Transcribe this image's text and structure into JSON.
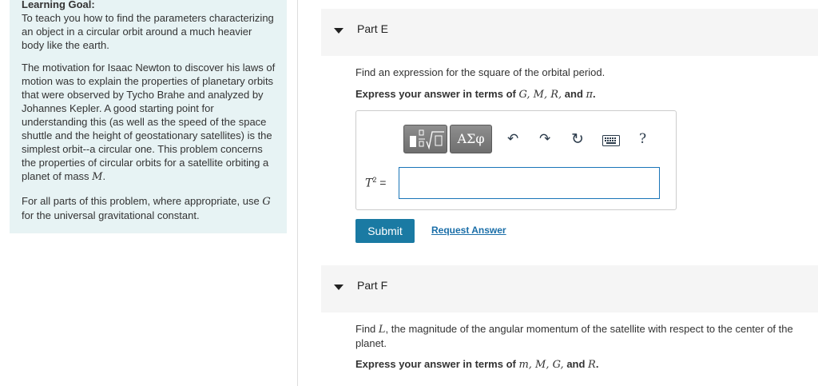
{
  "goal": {
    "title": "Learning Goal:",
    "p1": "To teach you how to find the parameters characterizing an object in a circular orbit around a much heavier body like the earth.",
    "p2_text": "The motivation for Isaac Newton to discover his laws of motion was to explain the properties of planetary orbits that were observed by Tycho Brahe and analyzed by Johannes Kepler. A good starting point for understanding this (as well as the speed of the space shuttle and the height of geostationary satellites) is the simplest orbit--a circular one. This problem concerns the properties of circular orbits for a satellite orbiting a planet of mass ",
    "p2_math": "M",
    "p2_end": ".",
    "p3_text": "For all parts of this problem, where appropriate, use ",
    "p3_math": "G",
    "p3_end": " for the universal gravitational constant."
  },
  "partE": {
    "label": "Part E",
    "question": "Find an expression for the square of the orbital period.",
    "instruction_prefix": "Express your answer in terms of ",
    "instruction_vars": "G, M, R,",
    "instruction_and": " and ",
    "instruction_last": "π",
    "instruction_end": ".",
    "answer_label": "T",
    "answer_sup": "2",
    "answer_eq": " =",
    "answer_value": "",
    "toolbar": {
      "templates_icon": "fraction-sqrt-icon",
      "symbols_label": "ΑΣφ",
      "undo_icon": "↶",
      "redo_icon": "↷",
      "reset_icon": "↻",
      "keyboard_icon": "keyboard-icon",
      "help_label": "?"
    },
    "submit_label": "Submit",
    "request_label": "Request Answer"
  },
  "partF": {
    "label": "Part F",
    "question_prefix": "Find ",
    "question_math": "L",
    "question_rest": ", the magnitude of the angular momentum of the satellite with respect to the center of the planet.",
    "instruction_prefix": "Express your answer in terms of ",
    "instruction_vars": "m, M, G,",
    "instruction_and": " and ",
    "instruction_last": "R",
    "instruction_end": "."
  }
}
